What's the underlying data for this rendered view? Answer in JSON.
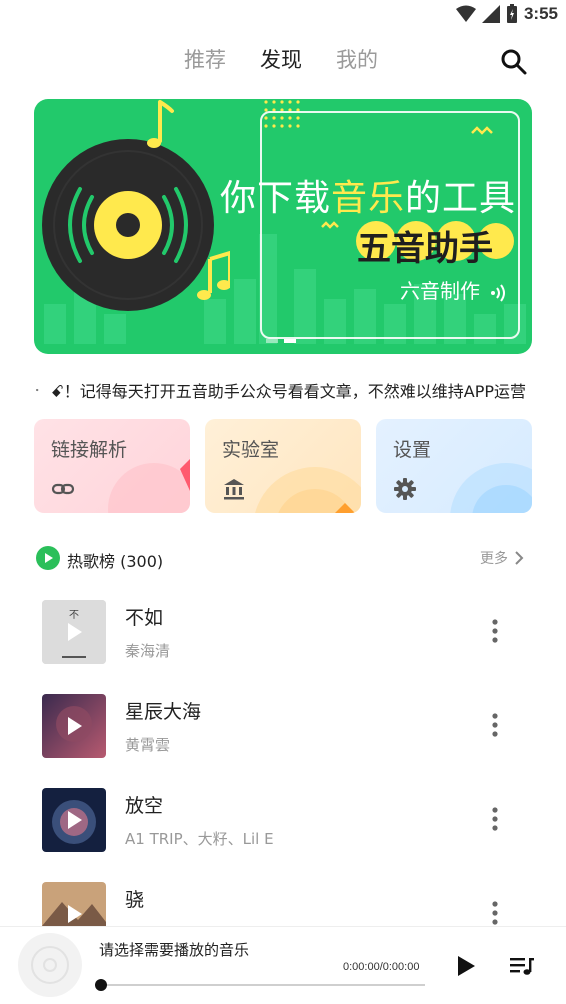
{
  "status_bar": {
    "time": "3:55"
  },
  "header": {
    "tabs": [
      {
        "label": "推荐",
        "active": false
      },
      {
        "label": "发现",
        "active": true
      },
      {
        "label": "我的",
        "active": false
      }
    ]
  },
  "banner": {
    "line1_a": "你下载",
    "line1_b": "音乐",
    "line1_c": "的工具",
    "line2": "五音助手",
    "line3": "六音制作",
    "bg_color": "#22c96b",
    "accent_color": "#ffe94d"
  },
  "notice": {
    "text": "ꗃ！记得每天打开五音助手公众号看看文章，不然难以维持APP运营"
  },
  "cards": [
    {
      "label": "链接解析",
      "icon": "link-icon"
    },
    {
      "label": "实验室",
      "icon": "bank-icon"
    },
    {
      "label": "设置",
      "icon": "gear-icon"
    }
  ],
  "section": {
    "title": "热歌榜 (300)",
    "more": "更多"
  },
  "songs": [
    {
      "title": "不如",
      "artist": "秦海清"
    },
    {
      "title": "星辰大海",
      "artist": "黄霄雲"
    },
    {
      "title": "放空",
      "artist": "A1 TRIP、大籽、Lil E"
    },
    {
      "title": "骁",
      "artist": ""
    }
  ],
  "player": {
    "title": "请选择需要播放的音乐",
    "time": "0:00:00/0:00:00",
    "progress": 0
  },
  "colors": {
    "accent_green": "#22c96b",
    "play_green": "#2bbf5a"
  }
}
